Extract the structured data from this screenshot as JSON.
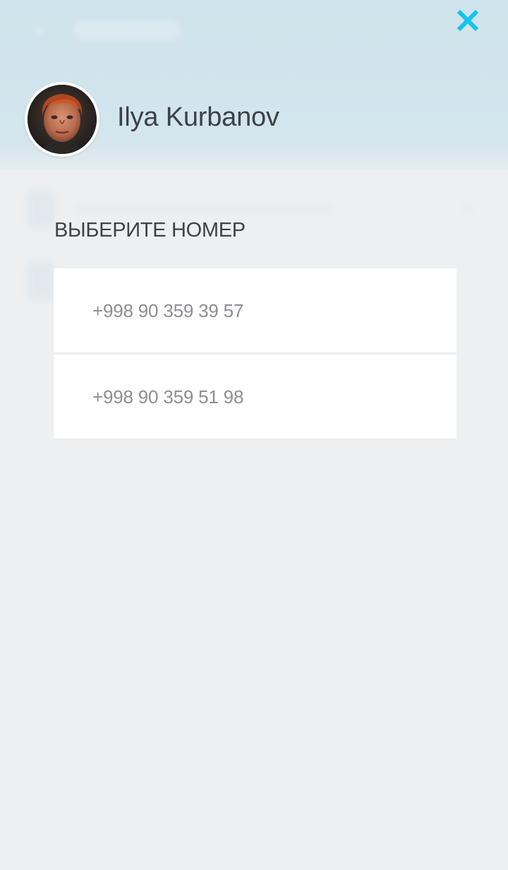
{
  "header": {
    "close_icon": "close-icon",
    "accent_color": "#14c3ef"
  },
  "contact": {
    "name": "Ilya Kurbanov",
    "avatar": "contact-avatar-photo"
  },
  "section": {
    "title": "ВЫБЕРИТЕ НОМЕР"
  },
  "phones": [
    {
      "number": "+998 90 359 39 57"
    },
    {
      "number": "+998 90 359 51 98"
    }
  ]
}
